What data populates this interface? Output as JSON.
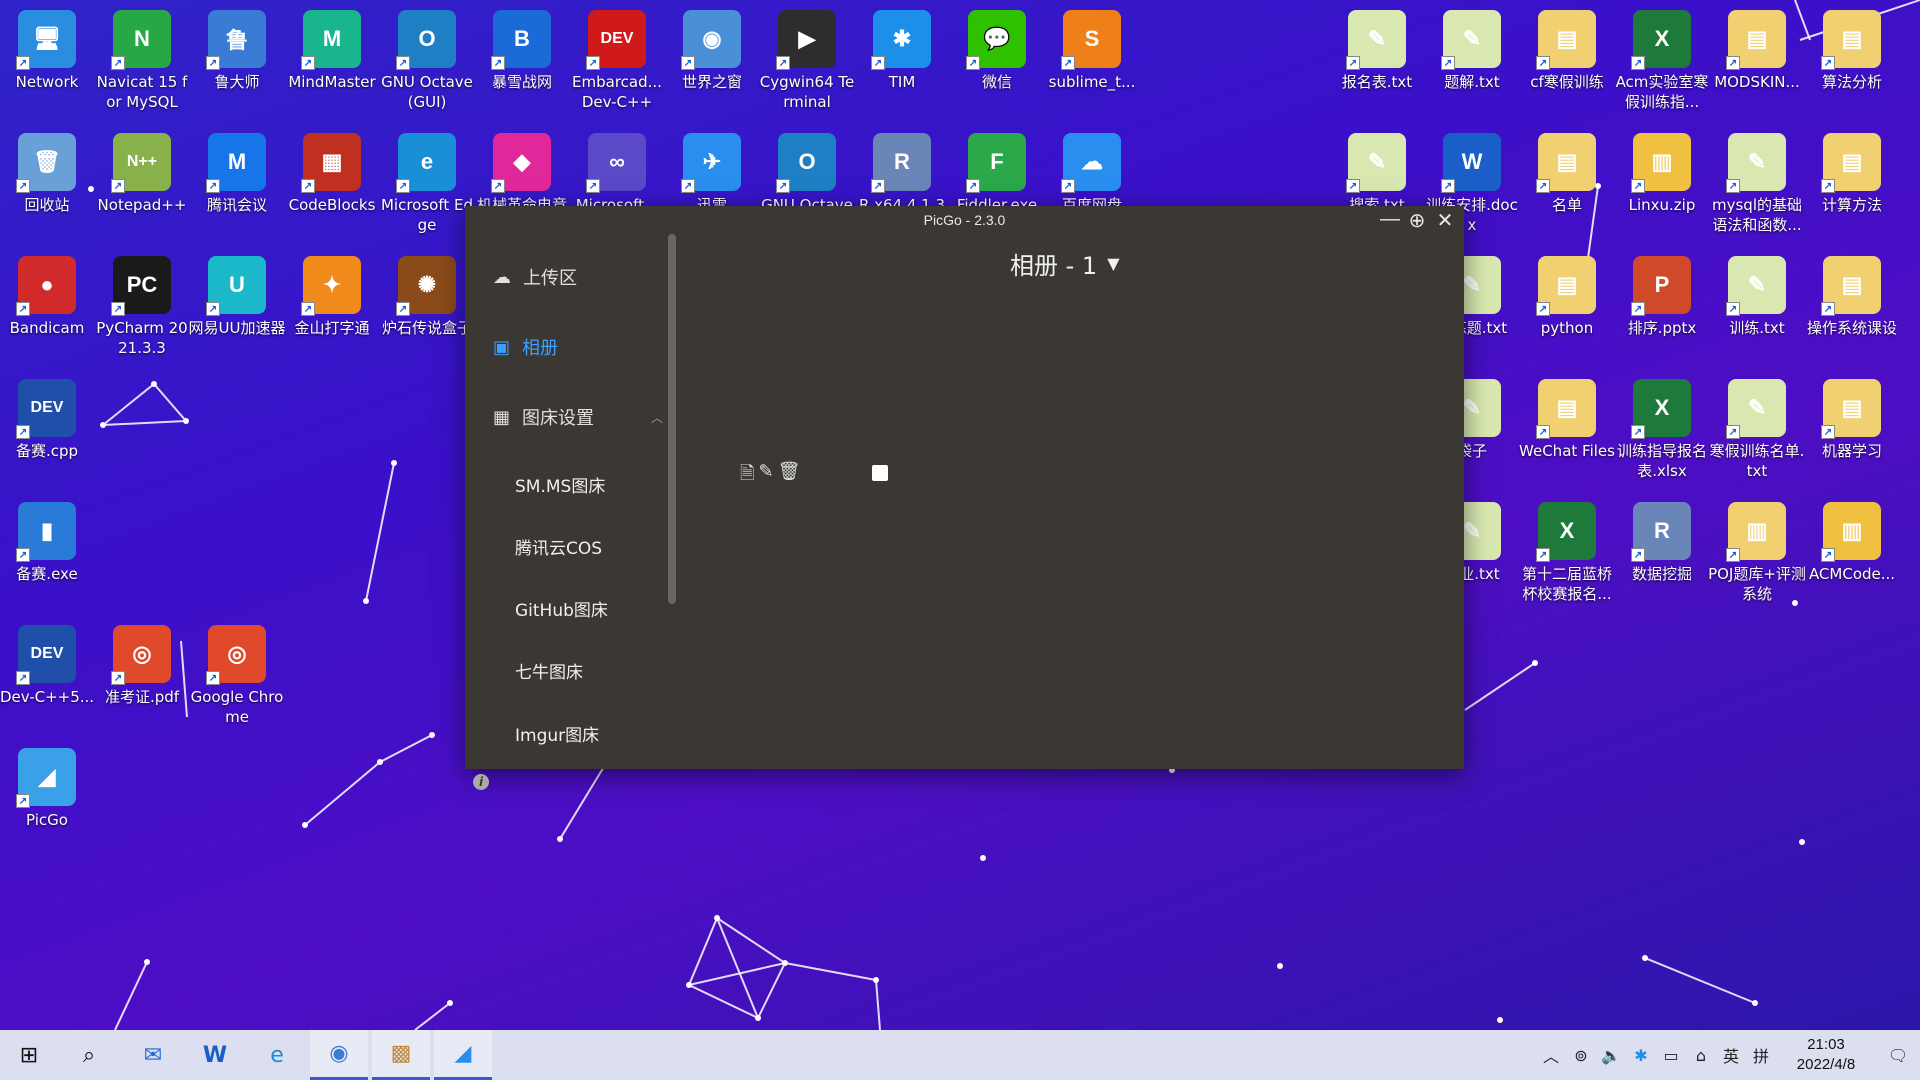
{
  "desktop": {
    "icons": [
      {
        "label": "Network",
        "color": "#2a8de0",
        "glyph": "🖥"
      },
      {
        "label": "Navicat 15 for MySQL",
        "color": "#27a844",
        "glyph": "N"
      },
      {
        "label": "鲁大师",
        "color": "#3a7bd5",
        "glyph": "鲁"
      },
      {
        "label": "MindMaster",
        "color": "#19b58c",
        "glyph": "M"
      },
      {
        "label": "GNU Octave (GUI)",
        "color": "#1f7fc4",
        "glyph": "O"
      },
      {
        "label": "暴雪战网",
        "color": "#1a6ad8",
        "glyph": "B"
      },
      {
        "label": "Embarcad... Dev-C++",
        "color": "#d01a1a",
        "glyph": "DEV"
      },
      {
        "label": "世界之窗",
        "color": "#4a90d9",
        "glyph": "◉"
      },
      {
        "label": "Cygwin64 Terminal",
        "color": "#2d2d2d",
        "glyph": "▶"
      },
      {
        "label": "TIM",
        "color": "#1c8fe8",
        "glyph": "✱"
      },
      {
        "label": "微信",
        "color": "#2dc100",
        "glyph": "💬"
      },
      {
        "label": "sublime_t...",
        "color": "#f07f1a",
        "glyph": "S"
      },
      {
        "label": "回收站",
        "color": "#6aa0d8",
        "glyph": "🗑"
      },
      {
        "label": "Notepad++",
        "color": "#88b04b",
        "glyph": "N++"
      },
      {
        "label": "腾讯会议",
        "color": "#1675e8",
        "glyph": "M"
      },
      {
        "label": "CodeBlocks",
        "color": "#c03020",
        "glyph": "▦"
      },
      {
        "label": "Microsoft Edge",
        "color": "#1a8fd8",
        "glyph": "e"
      },
      {
        "label": "机械革命电竞",
        "color": "#e0289a",
        "glyph": "◆"
      },
      {
        "label": "Microsoft...",
        "color": "#5a4ac8",
        "glyph": "∞"
      },
      {
        "label": "迅雷",
        "color": "#2a8ef0",
        "glyph": "✈"
      },
      {
        "label": "GNU Octave",
        "color": "#1f7fc4",
        "glyph": "O"
      },
      {
        "label": "R x64 4.1.3",
        "color": "#6a86b8",
        "glyph": "R"
      },
      {
        "label": "Fiddler.exe",
        "color": "#2aa84a",
        "glyph": "F"
      },
      {
        "label": "百度网盘",
        "color": "#2a8ef0",
        "glyph": "☁"
      },
      {
        "label": "Bandicam",
        "color": "#d02a2a",
        "glyph": "●"
      },
      {
        "label": "PyCharm 2021.3.3",
        "color": "#1a1a1a",
        "glyph": "PC"
      },
      {
        "label": "网易UU加速器",
        "color": "#1ab8c8",
        "glyph": "U"
      },
      {
        "label": "金山打字通",
        "color": "#f08a1a",
        "glyph": "✦"
      },
      {
        "label": "炉石传说盒子",
        "color": "#8a4a1a",
        "glyph": "✺"
      },
      {
        "label": "备赛.cpp",
        "color": "#1f4fa8",
        "glyph": "DEV"
      },
      {
        "label": "备赛.exe",
        "color": "#2a7ad8",
        "glyph": "▮"
      },
      {
        "label": "Dev-C++5...",
        "color": "#1f4fa8",
        "glyph": "DEV"
      },
      {
        "label": "准考证.pdf",
        "color": "#e04a2a",
        "glyph": "◎"
      },
      {
        "label": "Google Chrome",
        "color": "#e04a2a",
        "glyph": "◎"
      },
      {
        "label": "PicGo",
        "color": "#3aa0e8",
        "glyph": "◢"
      },
      {
        "label": "报名表.txt",
        "color": "#d8e8b0",
        "glyph": "✎"
      },
      {
        "label": "题解.txt",
        "color": "#d8e8b0",
        "glyph": "✎"
      },
      {
        "label": "cf寒假训练",
        "color": "#f0d070",
        "glyph": "▤"
      },
      {
        "label": "Acm实验室寒假训练指...",
        "color": "#1d7a3a",
        "glyph": "X"
      },
      {
        "label": "MODSKIN...",
        "color": "#f0d070",
        "glyph": "▤"
      },
      {
        "label": "算法分析",
        "color": "#f0d070",
        "glyph": "▤"
      },
      {
        "label": "搜索.txt",
        "color": "#d8e8b0",
        "glyph": "✎"
      },
      {
        "label": "训练安排.docx",
        "color": "#1a5fc8",
        "glyph": "W"
      },
      {
        "label": "名单",
        "color": "#f0d070",
        "glyph": "▤"
      },
      {
        "label": "Linxu.zip",
        "color": "#f0c040",
        "glyph": "▥"
      },
      {
        "label": "mysql的基础语法和函数...",
        "color": "#d8e8b0",
        "glyph": "✎"
      },
      {
        "label": "计算方法",
        "color": "#f0d070",
        "glyph": "▤"
      },
      {
        "label": "训练题.txt",
        "color": "#d8e8b0",
        "glyph": "✎"
      },
      {
        "label": "python",
        "color": "#f0d070",
        "glyph": "▤"
      },
      {
        "label": "排序.pptx",
        "color": "#d04a2a",
        "glyph": "P"
      },
      {
        "label": "训练.txt",
        "color": "#d8e8b0",
        "glyph": "✎"
      },
      {
        "label": "操作系统课设",
        "color": "#f0d070",
        "glyph": "▤"
      },
      {
        "label": "袋子",
        "color": "#d8e8b0",
        "glyph": "✎"
      },
      {
        "label": "WeChat Files",
        "color": "#f0d070",
        "glyph": "▤"
      },
      {
        "label": "训练指导报名表.xlsx",
        "color": "#1d7a3a",
        "glyph": "X"
      },
      {
        "label": "寒假训练名单.txt",
        "color": "#d8e8b0",
        "glyph": "✎"
      },
      {
        "label": "机器学习",
        "color": "#f0d070",
        "glyph": "▤"
      },
      {
        "label": "作业.txt",
        "color": "#d8e8b0",
        "glyph": "✎"
      },
      {
        "label": "第十二届蓝桥杯校赛报名...",
        "color": "#1d7a3a",
        "glyph": "X"
      },
      {
        "label": "数据挖掘",
        "color": "#6a86b8",
        "glyph": "R"
      },
      {
        "label": "POJ题库+评测系统",
        "color": "#f0d070",
        "glyph": "▥"
      },
      {
        "label": "ACMCode...",
        "color": "#f0c040",
        "glyph": "▥"
      }
    ]
  },
  "picgo": {
    "title": "PicGo - 2.3.0",
    "window_buttons": {
      "minimize": "—",
      "pin": "⊕",
      "close": "✕"
    },
    "nav": {
      "upload": "上传区",
      "gallery": "相册",
      "settings": "图床设置"
    },
    "hosts": [
      "SM.MS图床",
      "腾讯云COS",
      "GitHub图床",
      "七牛图床",
      "Imgur图床"
    ],
    "gallery_title": "相册 - 1",
    "accent": "#409eff"
  },
  "taskbar": {
    "time": "21:03",
    "date": "2022/4/8",
    "ime_lang": "英",
    "ime_mode": "拼"
  }
}
